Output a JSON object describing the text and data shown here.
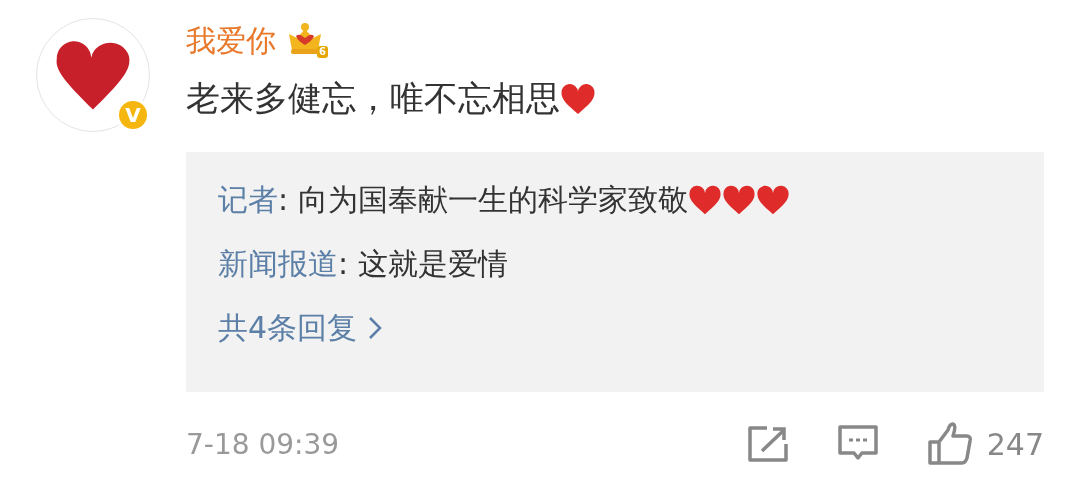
{
  "comment": {
    "author": "我爱你",
    "vip_level": "6",
    "verified_mark": "V",
    "text": "老来多健忘，唯不忘相思",
    "text_emojis": [
      {
        "kind": "heart"
      }
    ],
    "replies": [
      {
        "name": "记者",
        "text": ": 向为国奉献一生的科学家致敬",
        "emojis": [
          {
            "kind": "heart"
          },
          {
            "kind": "heart"
          },
          {
            "kind": "heart"
          }
        ]
      },
      {
        "name": "新闻报道",
        "text": ": 这就是爱情"
      }
    ],
    "more_replies": "共4条回复",
    "time": "7-18 09:39",
    "likes": "247"
  }
}
